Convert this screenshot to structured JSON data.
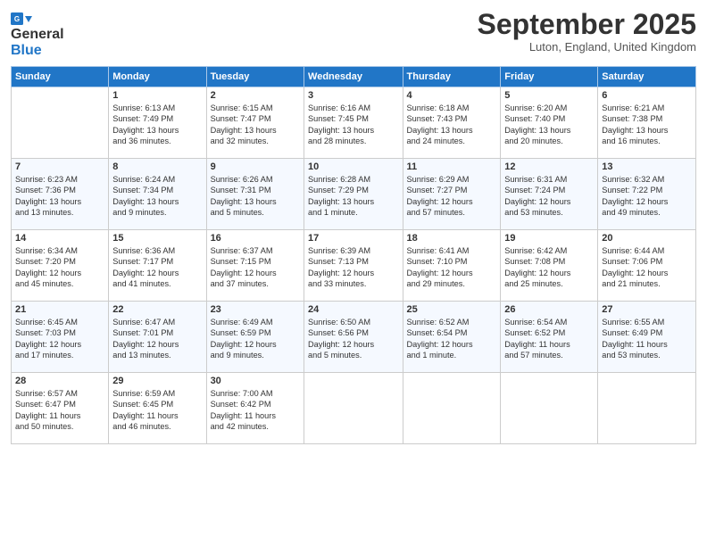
{
  "header": {
    "logo_line1": "General",
    "logo_line2": "Blue",
    "month_title": "September 2025",
    "subtitle": "Luton, England, United Kingdom"
  },
  "days_of_week": [
    "Sunday",
    "Monday",
    "Tuesday",
    "Wednesday",
    "Thursday",
    "Friday",
    "Saturday"
  ],
  "weeks": [
    [
      {
        "num": "",
        "info": ""
      },
      {
        "num": "1",
        "info": "Sunrise: 6:13 AM\nSunset: 7:49 PM\nDaylight: 13 hours\nand 36 minutes."
      },
      {
        "num": "2",
        "info": "Sunrise: 6:15 AM\nSunset: 7:47 PM\nDaylight: 13 hours\nand 32 minutes."
      },
      {
        "num": "3",
        "info": "Sunrise: 6:16 AM\nSunset: 7:45 PM\nDaylight: 13 hours\nand 28 minutes."
      },
      {
        "num": "4",
        "info": "Sunrise: 6:18 AM\nSunset: 7:43 PM\nDaylight: 13 hours\nand 24 minutes."
      },
      {
        "num": "5",
        "info": "Sunrise: 6:20 AM\nSunset: 7:40 PM\nDaylight: 13 hours\nand 20 minutes."
      },
      {
        "num": "6",
        "info": "Sunrise: 6:21 AM\nSunset: 7:38 PM\nDaylight: 13 hours\nand 16 minutes."
      }
    ],
    [
      {
        "num": "7",
        "info": "Sunrise: 6:23 AM\nSunset: 7:36 PM\nDaylight: 13 hours\nand 13 minutes."
      },
      {
        "num": "8",
        "info": "Sunrise: 6:24 AM\nSunset: 7:34 PM\nDaylight: 13 hours\nand 9 minutes."
      },
      {
        "num": "9",
        "info": "Sunrise: 6:26 AM\nSunset: 7:31 PM\nDaylight: 13 hours\nand 5 minutes."
      },
      {
        "num": "10",
        "info": "Sunrise: 6:28 AM\nSunset: 7:29 PM\nDaylight: 13 hours\nand 1 minute."
      },
      {
        "num": "11",
        "info": "Sunrise: 6:29 AM\nSunset: 7:27 PM\nDaylight: 12 hours\nand 57 minutes."
      },
      {
        "num": "12",
        "info": "Sunrise: 6:31 AM\nSunset: 7:24 PM\nDaylight: 12 hours\nand 53 minutes."
      },
      {
        "num": "13",
        "info": "Sunrise: 6:32 AM\nSunset: 7:22 PM\nDaylight: 12 hours\nand 49 minutes."
      }
    ],
    [
      {
        "num": "14",
        "info": "Sunrise: 6:34 AM\nSunset: 7:20 PM\nDaylight: 12 hours\nand 45 minutes."
      },
      {
        "num": "15",
        "info": "Sunrise: 6:36 AM\nSunset: 7:17 PM\nDaylight: 12 hours\nand 41 minutes."
      },
      {
        "num": "16",
        "info": "Sunrise: 6:37 AM\nSunset: 7:15 PM\nDaylight: 12 hours\nand 37 minutes."
      },
      {
        "num": "17",
        "info": "Sunrise: 6:39 AM\nSunset: 7:13 PM\nDaylight: 12 hours\nand 33 minutes."
      },
      {
        "num": "18",
        "info": "Sunrise: 6:41 AM\nSunset: 7:10 PM\nDaylight: 12 hours\nand 29 minutes."
      },
      {
        "num": "19",
        "info": "Sunrise: 6:42 AM\nSunset: 7:08 PM\nDaylight: 12 hours\nand 25 minutes."
      },
      {
        "num": "20",
        "info": "Sunrise: 6:44 AM\nSunset: 7:06 PM\nDaylight: 12 hours\nand 21 minutes."
      }
    ],
    [
      {
        "num": "21",
        "info": "Sunrise: 6:45 AM\nSunset: 7:03 PM\nDaylight: 12 hours\nand 17 minutes."
      },
      {
        "num": "22",
        "info": "Sunrise: 6:47 AM\nSunset: 7:01 PM\nDaylight: 12 hours\nand 13 minutes."
      },
      {
        "num": "23",
        "info": "Sunrise: 6:49 AM\nSunset: 6:59 PM\nDaylight: 12 hours\nand 9 minutes."
      },
      {
        "num": "24",
        "info": "Sunrise: 6:50 AM\nSunset: 6:56 PM\nDaylight: 12 hours\nand 5 minutes."
      },
      {
        "num": "25",
        "info": "Sunrise: 6:52 AM\nSunset: 6:54 PM\nDaylight: 12 hours\nand 1 minute."
      },
      {
        "num": "26",
        "info": "Sunrise: 6:54 AM\nSunset: 6:52 PM\nDaylight: 11 hours\nand 57 minutes."
      },
      {
        "num": "27",
        "info": "Sunrise: 6:55 AM\nSunset: 6:49 PM\nDaylight: 11 hours\nand 53 minutes."
      }
    ],
    [
      {
        "num": "28",
        "info": "Sunrise: 6:57 AM\nSunset: 6:47 PM\nDaylight: 11 hours\nand 50 minutes."
      },
      {
        "num": "29",
        "info": "Sunrise: 6:59 AM\nSunset: 6:45 PM\nDaylight: 11 hours\nand 46 minutes."
      },
      {
        "num": "30",
        "info": "Sunrise: 7:00 AM\nSunset: 6:42 PM\nDaylight: 11 hours\nand 42 minutes."
      },
      {
        "num": "",
        "info": ""
      },
      {
        "num": "",
        "info": ""
      },
      {
        "num": "",
        "info": ""
      },
      {
        "num": "",
        "info": ""
      }
    ]
  ]
}
